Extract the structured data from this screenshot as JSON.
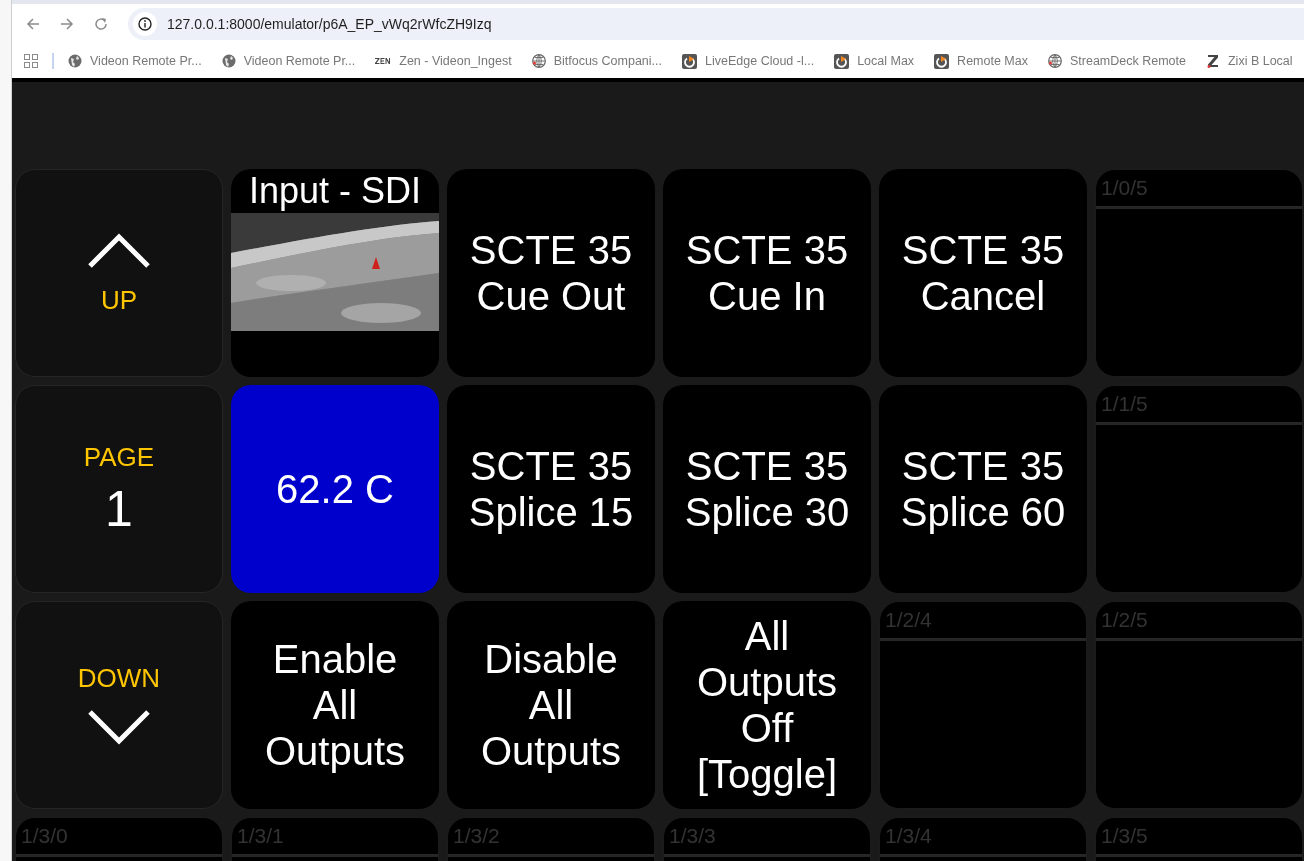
{
  "browser": {
    "url": "127.0.0.1:8000/emulator/p6A_EP_vWq2rWfcZH9Izq",
    "bookmarks": [
      {
        "label": "Videon Remote Pr...",
        "kind": "globe"
      },
      {
        "label": "Videon Remote Pr...",
        "kind": "globe"
      },
      {
        "label": "Zen - Videon_Ingest",
        "kind": "zen"
      },
      {
        "label": "Bitfocus Compani...",
        "kind": "sphere"
      },
      {
        "label": "LiveEdge Cloud -l...",
        "kind": "play"
      },
      {
        "label": "Local Max",
        "kind": "play"
      },
      {
        "label": "Remote Max",
        "kind": "play"
      },
      {
        "label": "StreamDeck Remote",
        "kind": "sphere"
      },
      {
        "label": "Zixi B Local",
        "kind": "z"
      }
    ]
  },
  "grid": {
    "rows": [
      [
        {
          "kind": "nav_up",
          "label": "UP"
        },
        {
          "label": "Input - SDI"
        },
        {
          "kind": "text",
          "label": "SCTE 35 Cue Out"
        },
        {
          "kind": "text",
          "label": "SCTE 35 Cue In"
        },
        {
          "kind": "text",
          "label": "SCTE 35 Cancel"
        },
        {
          "kind": "empty",
          "label": "1/0/5"
        }
      ],
      [
        {
          "kind": "page",
          "label": "PAGE",
          "value": "1"
        },
        {
          "kind": "text",
          "label": "62.2 C",
          "color": "#0000cc"
        },
        {
          "kind": "text",
          "label": "SCTE 35 Splice 15"
        },
        {
          "kind": "text",
          "label": "SCTE 35 Splice 30"
        },
        {
          "kind": "text",
          "label": "SCTE 35 Splice 60"
        },
        {
          "kind": "empty",
          "label": "1/1/5"
        }
      ],
      [
        {
          "kind": "nav_down",
          "label": "DOWN"
        },
        {
          "kind": "text",
          "label": "Enable All Outputs"
        },
        {
          "kind": "text",
          "label": "Disable All Outputs"
        },
        {
          "kind": "text",
          "label": "All Outputs Off [Toggle]"
        },
        {
          "kind": "empty",
          "label": "1/2/4"
        },
        {
          "kind": "empty",
          "label": "1/2/5"
        }
      ],
      [
        {
          "kind": "empty",
          "label": "1/3/0"
        },
        {
          "kind": "empty",
          "label": "1/3/1"
        },
        {
          "kind": "empty",
          "label": "1/3/2"
        },
        {
          "kind": "empty",
          "label": "1/3/3"
        },
        {
          "kind": "empty",
          "label": "1/3/4"
        },
        {
          "kind": "empty",
          "label": "1/3/5"
        }
      ]
    ]
  }
}
